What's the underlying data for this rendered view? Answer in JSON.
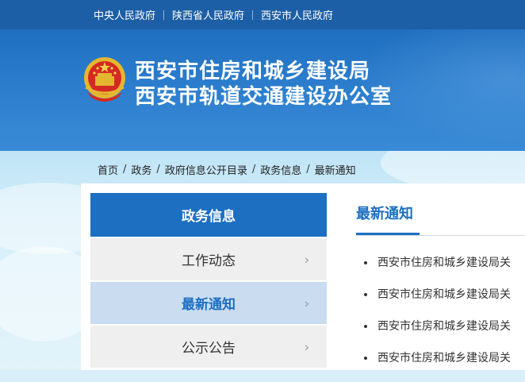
{
  "top_links": [
    "中央人民政府",
    "陕西省人民政府",
    "西安市人民政府"
  ],
  "header": {
    "title_line1": "西安市住房和城乡建设局",
    "title_line2": "西安市轨道交通建设办公室"
  },
  "breadcrumb": [
    "首页",
    "政务",
    "政府信息公开目录",
    "政务信息",
    "最新通知"
  ],
  "sidebar": {
    "heading": "政务信息",
    "items": [
      {
        "label": "工作动态",
        "active": false
      },
      {
        "label": "最新通知",
        "active": true
      },
      {
        "label": "公示公告",
        "active": false
      }
    ]
  },
  "content": {
    "title": "最新通知",
    "items": [
      "西安市住房和城乡建设局关",
      "西安市住房和城乡建设局关",
      "西安市住房和城乡建设局关",
      "西安市住房和城乡建设局关"
    ]
  },
  "colors": {
    "primary": "#1d6fc2",
    "topbar": "#1d5fa6",
    "active_bg": "#c9dcf0"
  },
  "icons": {
    "emblem": "national-emblem-icon",
    "chevron": "chevron-right-icon"
  }
}
